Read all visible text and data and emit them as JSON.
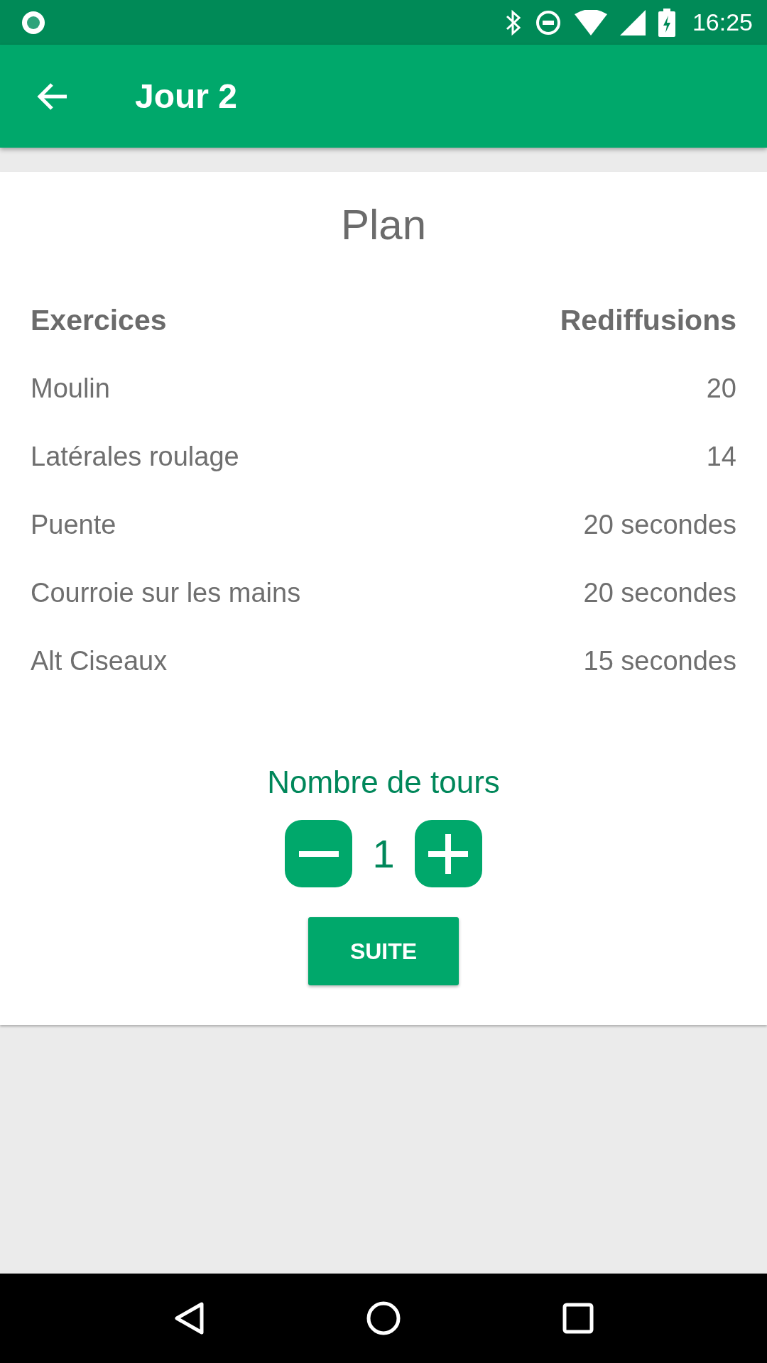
{
  "status_bar": {
    "time": "16:25"
  },
  "app_bar": {
    "title": "Jour 2"
  },
  "plan": {
    "title": "Plan",
    "columns": [
      "Exercices",
      "Rediffusions"
    ],
    "rows": [
      {
        "exercise": "Moulin",
        "reps": "20"
      },
      {
        "exercise": "Latérales roulage",
        "reps": "14"
      },
      {
        "exercise": "Puente",
        "reps": "20 secondes"
      },
      {
        "exercise": "Courroie sur les mains",
        "reps": "20 secondes"
      },
      {
        "exercise": "Alt Ciseaux",
        "reps": "15 secondes"
      }
    ]
  },
  "rounds": {
    "label": "Nombre de tours",
    "value": "1"
  },
  "next_button": {
    "label": "SUITE"
  }
}
